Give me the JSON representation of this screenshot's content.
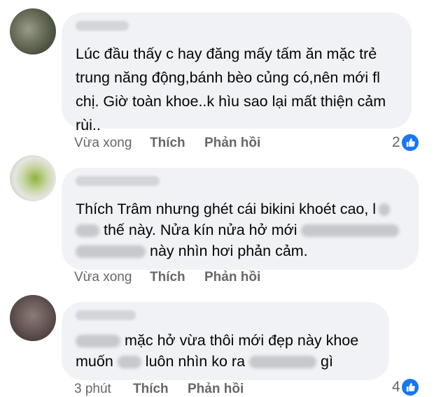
{
  "comments": [
    {
      "text_lines": [
        "Lúc đầu thấy c hay đăng mấy tấm ăn mặc trẻ",
        "trung năng động,bánh bèo củng có,nên mới fl",
        "chị. Giờ toàn khoe..k hìu sao lại mất thiện cảm",
        "rùi.."
      ],
      "time": "Vừa xong",
      "like_label": "Thích",
      "reply_label": "Phản hồi",
      "reaction_count": "2"
    },
    {
      "text_lines": [
        "Thích Trâm nhưng ghét cái bikini khoét cao, l",
        "thế này. Nửa kín nửa hở mới",
        "này nhìn hơi phản cảm."
      ],
      "time": "Vừa xong",
      "like_label": "Thích",
      "reply_label": "Phản hồi"
    },
    {
      "text_lines": [
        "mặc hở vừa thôi mới đẹp này khoe",
        "muốn",
        "luôn nhìn ko ra",
        "gì"
      ],
      "time": "3 phút",
      "like_label": "Thích",
      "reply_label": "Phản hồi",
      "reaction_count": "4"
    }
  ],
  "colors": {
    "bubble": "#f0f2f5",
    "secondary_text": "#65676b",
    "like_blue": "#1877f2"
  },
  "icons": {
    "reaction": "like-thumb-icon"
  }
}
